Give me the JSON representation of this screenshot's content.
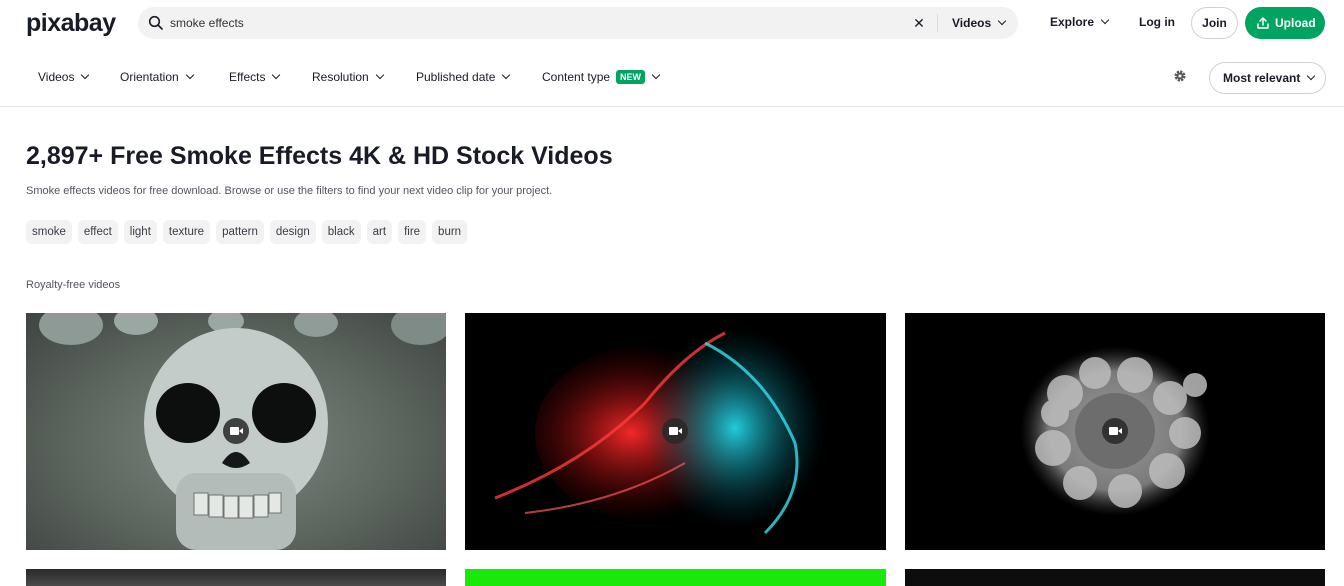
{
  "header": {
    "logo": "pixabay",
    "search": {
      "value": "smoke effects",
      "clear_icon": "close-icon"
    },
    "media_type": "Videos",
    "explore": "Explore",
    "login": "Log in",
    "join": "Join",
    "upload": "Upload"
  },
  "filters": {
    "items": [
      "Videos",
      "Orientation",
      "Effects",
      "Resolution",
      "Published date",
      "Content type"
    ],
    "new_badge": "NEW",
    "sort": "Most relevant"
  },
  "main": {
    "title": "2,897+ Free Smoke Effects 4K & HD Stock Videos",
    "subtitle": "Smoke effects videos for free download. Browse or use the filters to find your next video clip for your project.",
    "tags": [
      "smoke",
      "effect",
      "light",
      "texture",
      "pattern",
      "design",
      "black",
      "art",
      "fire",
      "burn"
    ],
    "section_label": "Royalty-free videos"
  },
  "colors": {
    "accent": "#00a460",
    "text": "#191b26",
    "muted": "#545560",
    "chip_bg": "#f2f2f2"
  }
}
